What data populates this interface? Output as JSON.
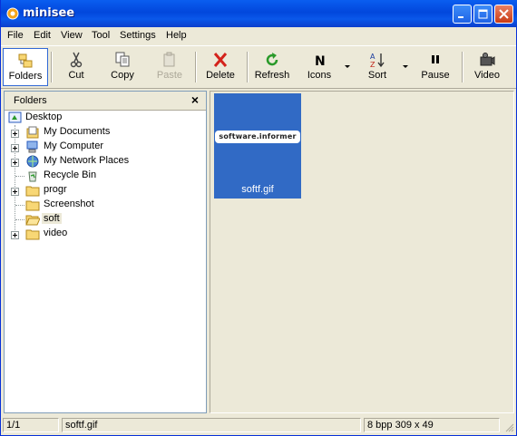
{
  "window": {
    "title": "minisee"
  },
  "menu": [
    "File",
    "Edit",
    "View",
    "Tool",
    "Settings",
    "Help"
  ],
  "toolbar": {
    "folders": "Folders",
    "cut": "Cut",
    "copy": "Copy",
    "paste": "Paste",
    "delete": "Delete",
    "refresh": "Refresh",
    "icons": "Icons",
    "sort": "Sort",
    "pause": "Pause",
    "video": "Video"
  },
  "icons": {
    "folders": "folder-tree-icon",
    "cut": "scissors-icon",
    "copy": "copy-icon",
    "paste": "paste-icon",
    "delete": "red-x-icon",
    "refresh": "green-refresh-icon",
    "icons": "letter-n-icon",
    "sort": "az-sort-icon",
    "pause": "pause-icon",
    "video": "camera-icon"
  },
  "folders_panel": {
    "title": "Folders",
    "close": "×",
    "tree": [
      {
        "label": "Desktop"
      },
      {
        "label": "My Documents"
      },
      {
        "label": "My Computer"
      },
      {
        "label": "My Network Places"
      },
      {
        "label": "Recycle Bin"
      },
      {
        "label": "progr"
      },
      {
        "label": "Screenshot"
      },
      {
        "label": "soft"
      },
      {
        "label": "video"
      }
    ]
  },
  "content": {
    "thumbnail": {
      "filename": "softf.gif",
      "image_text": "software.informer"
    }
  },
  "status": {
    "index": "1/1",
    "filename": "softf.gif",
    "info": "8 bpp  309 x 49"
  },
  "colors": {
    "titlebar": "#0a5ef0",
    "selection": "#316ac5",
    "chrome": "#ece9d8"
  }
}
